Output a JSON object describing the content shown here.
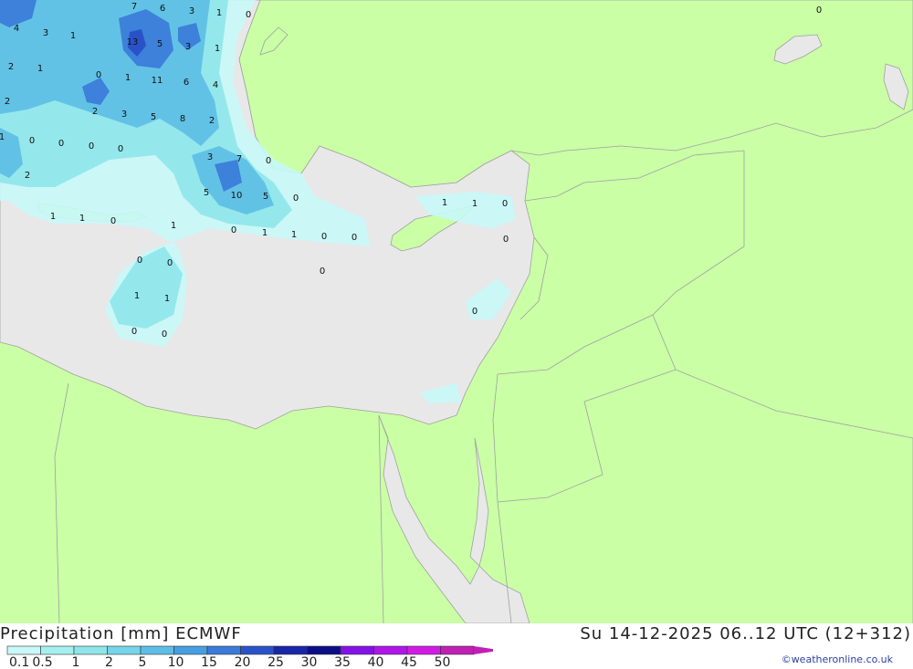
{
  "header": {
    "title_left": "Precipitation [mm] ECMWF",
    "title_right": "Su 14-12-2025 06..12 UTC (12+312)"
  },
  "credit": "©weatheronline.co.uk",
  "legend": {
    "labels": [
      "0.1",
      "0.5",
      "1",
      "2",
      "5",
      "10",
      "15",
      "20",
      "25",
      "30",
      "35",
      "40",
      "45",
      "50"
    ],
    "colors": [
      "#c8f8f8",
      "#a4f0f0",
      "#8ee6ea",
      "#74d6e8",
      "#5cbee6",
      "#469fe0",
      "#3a7ad8",
      "#2a52c8",
      "#1826a8",
      "#0c0e86",
      "#8412e6",
      "#b016ea",
      "#d21ae6",
      "#c020b4"
    ],
    "colors_key": "legend.colors"
  },
  "map": {
    "colors": {
      "land": "#caffa6",
      "sea": "#e8e8e8",
      "border": "#a0a0a0"
    },
    "labels": [
      {
        "t": "7"
      },
      {
        "t": "6"
      },
      {
        "t": "3"
      },
      {
        "t": "1"
      },
      {
        "t": "0"
      },
      {
        "t": "0"
      },
      {
        "t": "4"
      },
      {
        "t": "3"
      },
      {
        "t": "1"
      },
      {
        "t": "13"
      },
      {
        "t": "5"
      },
      {
        "t": "3"
      },
      {
        "t": "1"
      },
      {
        "t": "2"
      },
      {
        "t": "1"
      },
      {
        "t": "0"
      },
      {
        "t": "1"
      },
      {
        "t": "11"
      },
      {
        "t": "6"
      },
      {
        "t": "4"
      },
      {
        "t": "2"
      },
      {
        "t": "2"
      },
      {
        "t": "3"
      },
      {
        "t": "5"
      },
      {
        "t": "8"
      },
      {
        "t": "2"
      },
      {
        "t": "1"
      },
      {
        "t": "0"
      },
      {
        "t": "0"
      },
      {
        "t": "0"
      },
      {
        "t": "0"
      },
      {
        "t": "3"
      },
      {
        "t": "7"
      },
      {
        "t": "0"
      },
      {
        "t": "2"
      },
      {
        "t": "5"
      },
      {
        "t": "10"
      },
      {
        "t": "5"
      },
      {
        "t": "0"
      },
      {
        "t": "1"
      },
      {
        "t": "1"
      },
      {
        "t": "0"
      },
      {
        "t": "1"
      },
      {
        "t": "0"
      },
      {
        "t": "1"
      },
      {
        "t": "1"
      },
      {
        "t": "0"
      },
      {
        "t": "0"
      },
      {
        "t": "1"
      },
      {
        "t": "1"
      },
      {
        "t": "0"
      },
      {
        "t": "0"
      },
      {
        "t": "0"
      },
      {
        "t": "0"
      },
      {
        "t": "0"
      },
      {
        "t": "1"
      },
      {
        "t": "1"
      },
      {
        "t": "0"
      },
      {
        "t": "0"
      },
      {
        "t": "0"
      }
    ]
  }
}
